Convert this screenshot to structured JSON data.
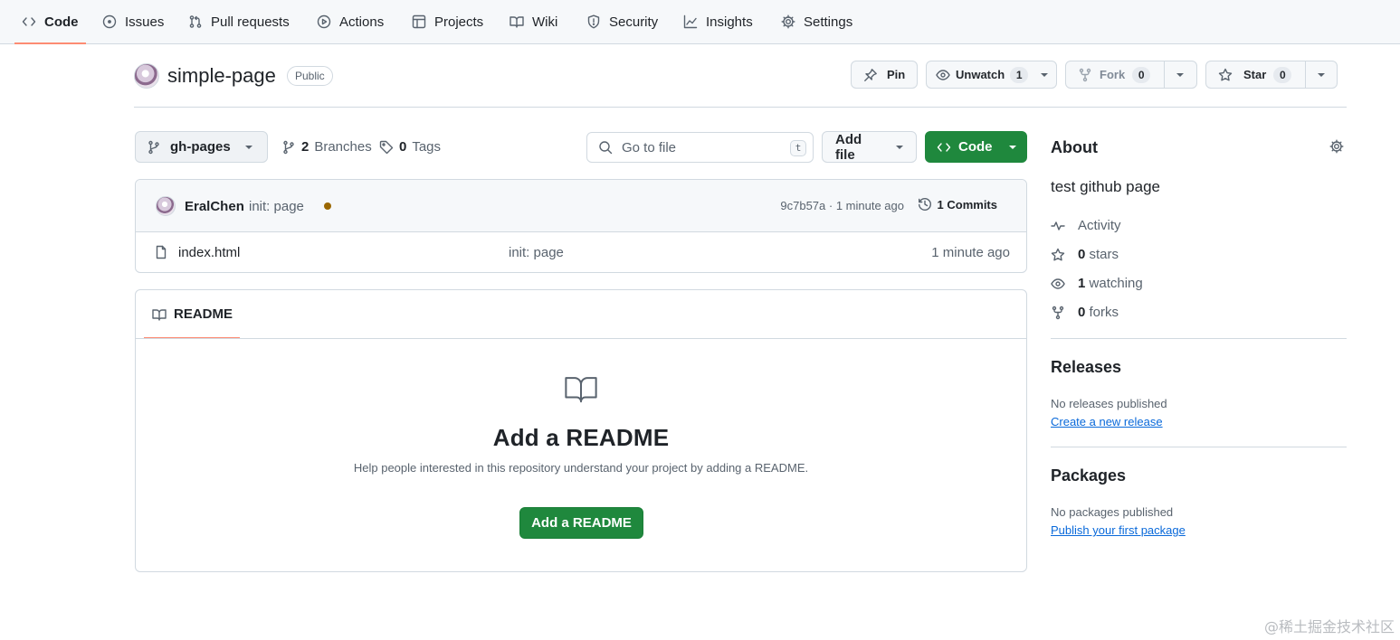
{
  "nav": {
    "tabs": [
      {
        "label": "Code",
        "icon": "code-icon"
      },
      {
        "label": "Issues",
        "icon": "issue-icon"
      },
      {
        "label": "Pull requests",
        "icon": "pull-request-icon"
      },
      {
        "label": "Actions",
        "icon": "play-icon"
      },
      {
        "label": "Projects",
        "icon": "table-icon"
      },
      {
        "label": "Wiki",
        "icon": "book-icon"
      },
      {
        "label": "Security",
        "icon": "shield-icon"
      },
      {
        "label": "Insights",
        "icon": "graph-icon"
      },
      {
        "label": "Settings",
        "icon": "gear-icon"
      }
    ],
    "active": "Code"
  },
  "repo": {
    "name": "simple-page",
    "visibility": "Public",
    "pin_label": "Pin",
    "watch_label": "Unwatch",
    "watch_count": "1",
    "fork_label": "Fork",
    "fork_count": "0",
    "star_label": "Star",
    "star_count": "0"
  },
  "toolbar": {
    "branch": "gh-pages",
    "branches_count": "2",
    "branches_label": "Branches",
    "tags_count": "0",
    "tags_label": "Tags",
    "goto_placeholder": "Go to file",
    "goto_shortcut": "t",
    "add_file_label": "Add file",
    "code_label": "Code"
  },
  "commit": {
    "author": "EralChen",
    "message": "init: page",
    "sha_time": "9c7b57a · 1 minute ago",
    "commits_label": "1 Commits",
    "status_color": "#9a6700"
  },
  "files": [
    {
      "name": "index.html",
      "message": "init: page",
      "time": "1 minute ago"
    }
  ],
  "readme": {
    "tab_label": "README",
    "title": "Add a README",
    "description": "Help people interested in this repository understand your project by adding a README.",
    "button_label": "Add a README"
  },
  "about": {
    "heading": "About",
    "description": "test github page",
    "activity_label": "Activity",
    "stars_count": "0",
    "stars_label": "stars",
    "watching_count": "1",
    "watching_label": "watching",
    "forks_count": "0",
    "forks_label": "forks"
  },
  "releases": {
    "heading": "Releases",
    "text": "No releases published",
    "link": "Create a new release"
  },
  "packages": {
    "heading": "Packages",
    "text": "No packages published",
    "link": "Publish your first package"
  },
  "watermark": "@稀土掘金技术社区",
  "colors": {
    "accent_green": "#1f883d",
    "tab_underline": "#fd8c73",
    "link_blue": "#0969da"
  }
}
